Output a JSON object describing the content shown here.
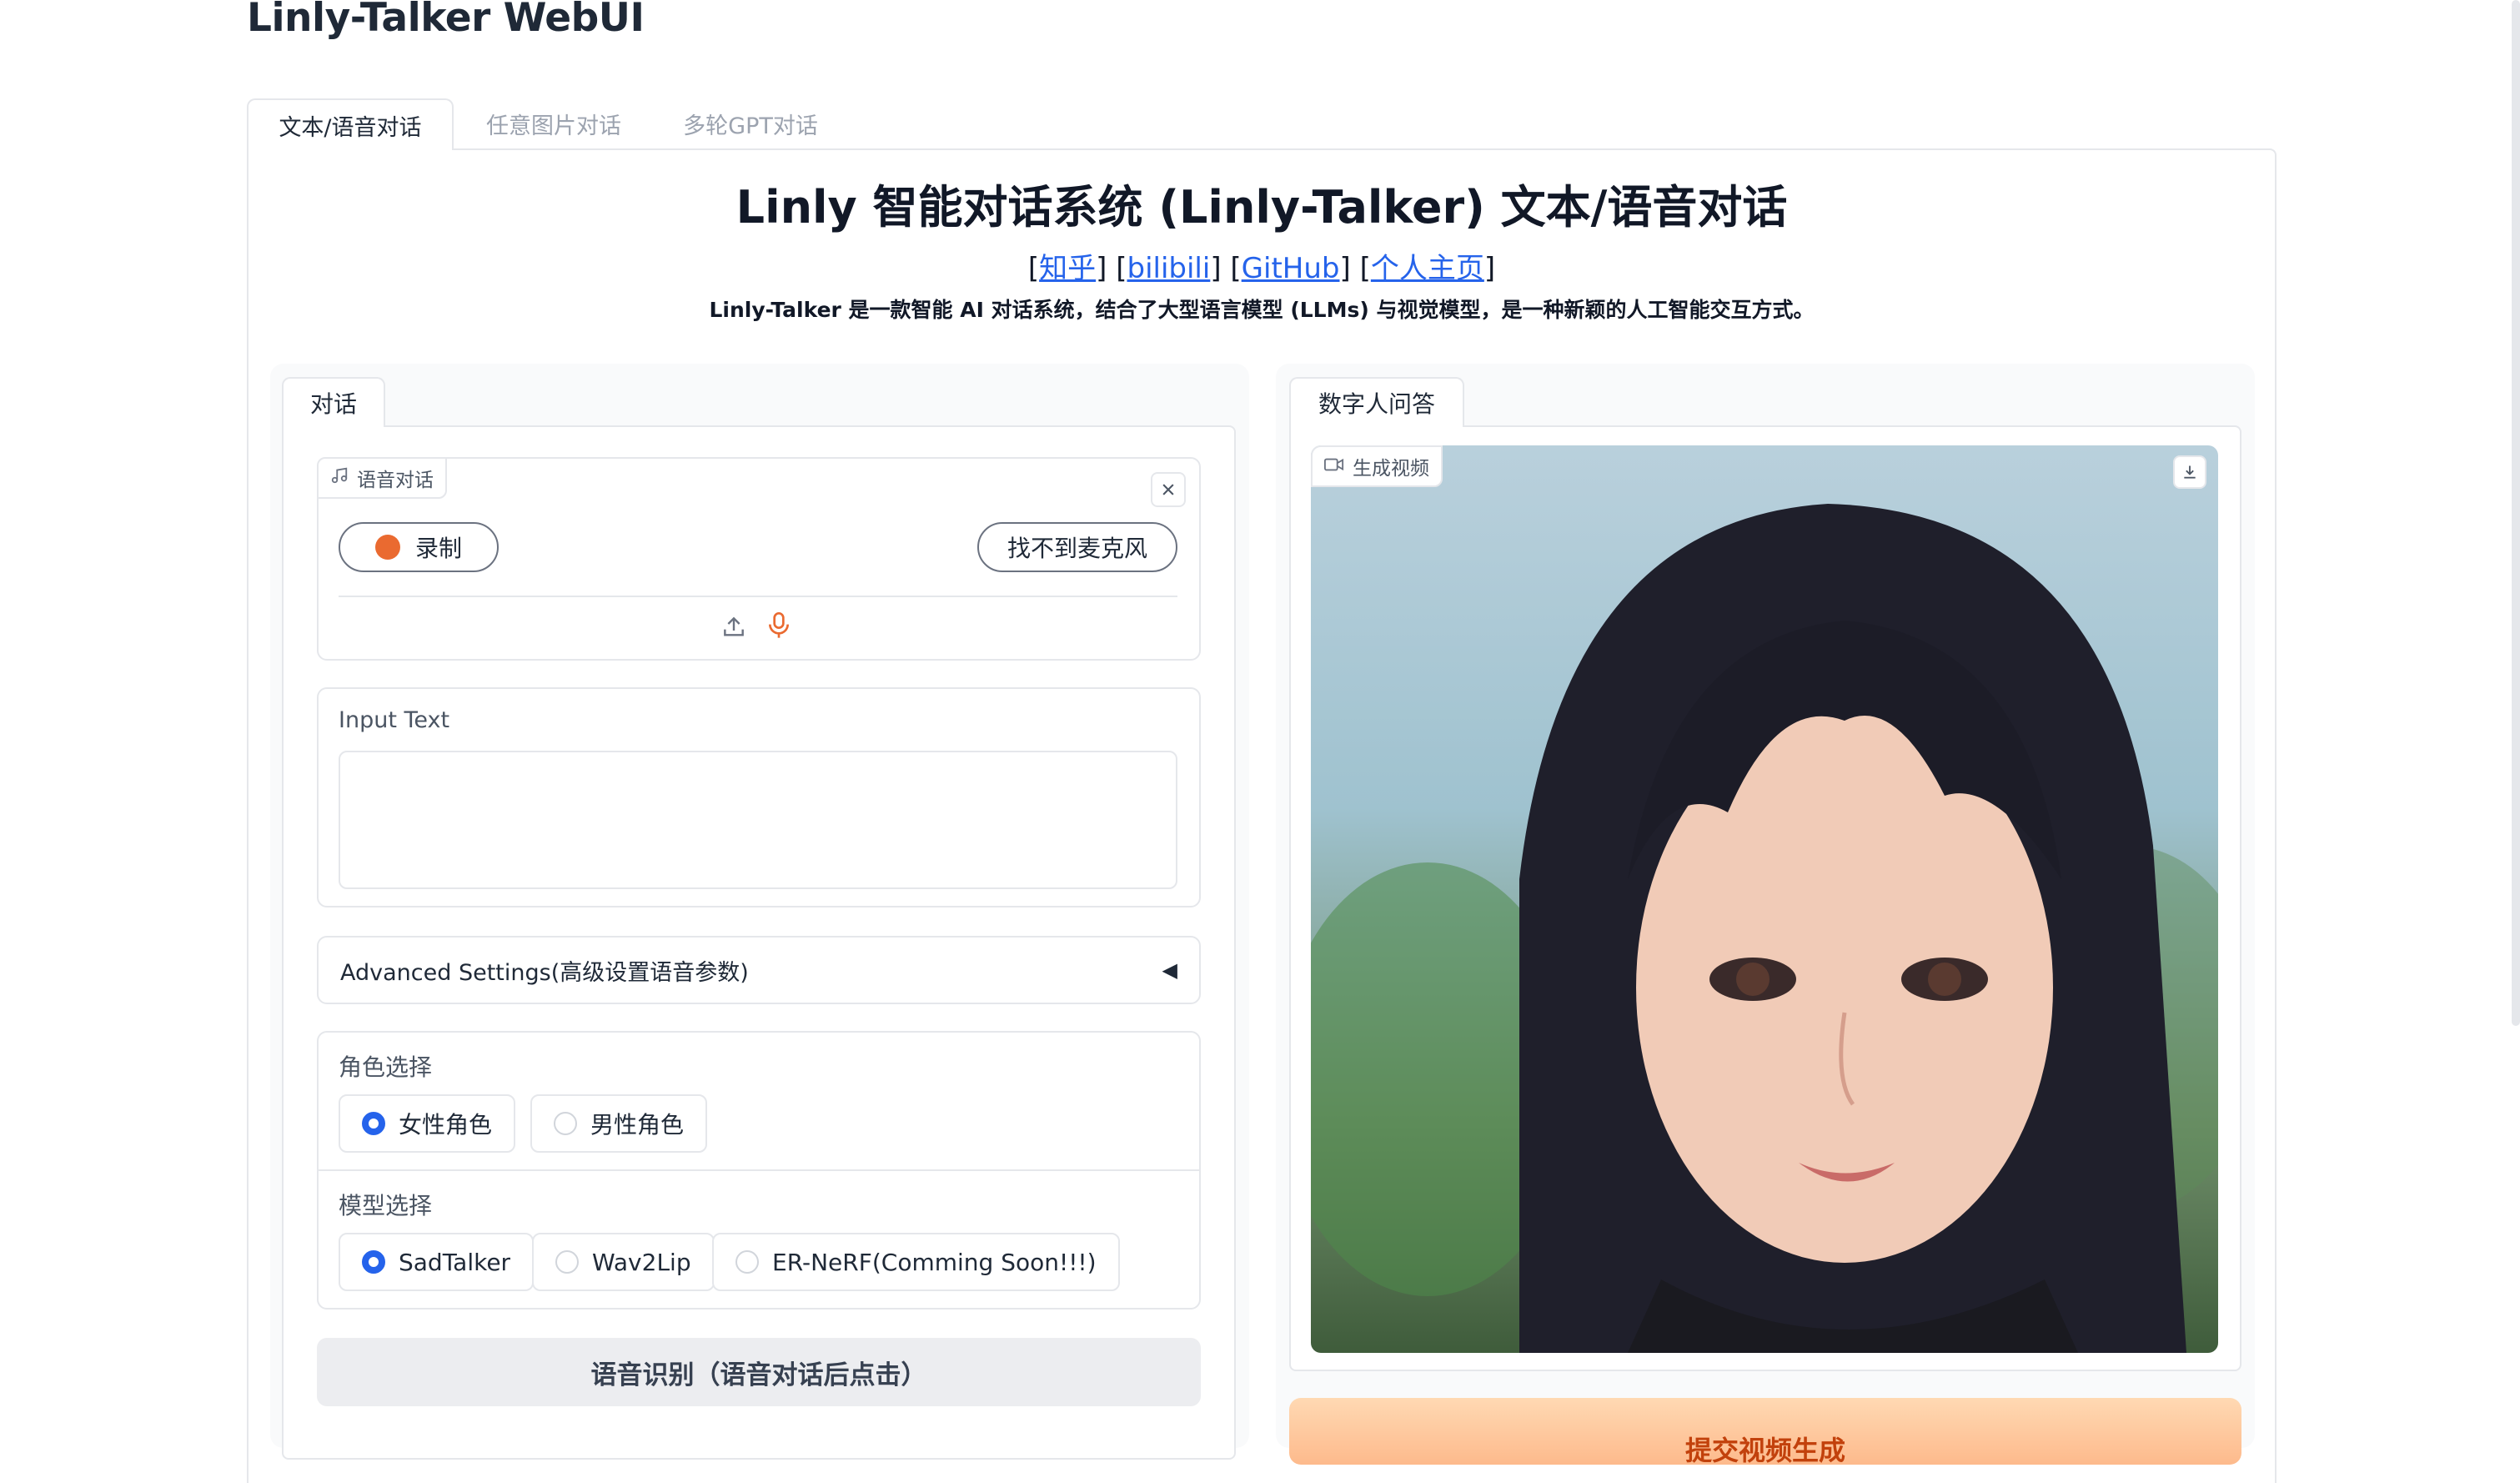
{
  "app": {
    "title": "Linly-Talker WebUI"
  },
  "tabs": [
    {
      "label": "文本/语音对话",
      "active": true
    },
    {
      "label": "任意图片对话",
      "active": false
    },
    {
      "label": "多轮GPT对话",
      "active": false
    }
  ],
  "header": {
    "title": "Linly 智能对话系统 (Linly-Talker) 文本/语音对话",
    "links": [
      "知乎",
      "bilibili",
      "GitHub",
      "个人主页"
    ],
    "subtitle": "Linly-Talker 是一款智能 AI 对话系统，结合了大型语言模型 (LLMs) 与视觉模型，是一种新颖的人工智能交互方式。"
  },
  "left": {
    "tab_label": "对话",
    "audio": {
      "label": "语音对话",
      "record_label": "录制",
      "mic_status": "找不到麦克风",
      "icon_music": "music-note-icon",
      "icon_close": "close-icon",
      "icon_upload": "upload-icon",
      "icon_mic": "microphone-icon"
    },
    "input_text": {
      "label": "Input Text",
      "value": "",
      "placeholder": ""
    },
    "advanced": {
      "label": "Advanced Settings(高级设置语音参数)",
      "collapsed": true
    },
    "role": {
      "label": "角色选择",
      "options": [
        "女性角色",
        "男性角色"
      ],
      "selected": "女性角色"
    },
    "model": {
      "label": "模型选择",
      "options": [
        "SadTalker",
        "Wav2Lip",
        "ER-NeRF(Comming Soon!!!)"
      ],
      "selected": "SadTalker"
    },
    "asr_button": "语音识别（语音对话后点击）"
  },
  "right": {
    "tab_label": "数字人问答",
    "video": {
      "label": "生成视频",
      "icon_video": "video-camera-icon",
      "icon_download": "download-icon"
    },
    "submit_button": "提交视频生成"
  },
  "colors": {
    "accent": "#2563eb",
    "record": "#ea6a30",
    "primary_button": "#fdba8c"
  }
}
